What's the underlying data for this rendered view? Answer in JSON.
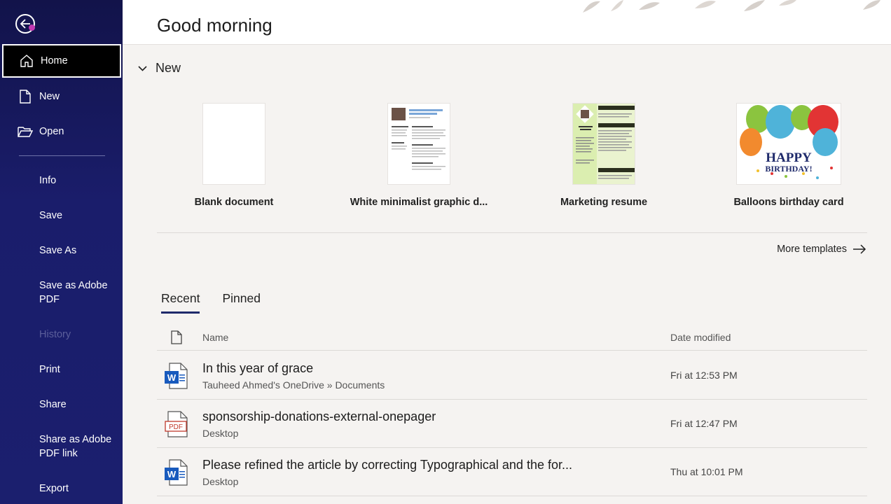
{
  "header": {
    "greeting": "Good morning"
  },
  "sidebar": {
    "back_icon": "back-arrow-icon",
    "items": [
      {
        "label": "Home",
        "icon": "home-icon",
        "active": true
      },
      {
        "label": "New",
        "icon": "new-document-icon"
      },
      {
        "label": "Open",
        "icon": "folder-open-icon"
      }
    ],
    "secondary": [
      {
        "label": "Info"
      },
      {
        "label": "Save"
      },
      {
        "label": "Save As"
      },
      {
        "label": "Save as Adobe\nPDF"
      },
      {
        "label": "History",
        "disabled": true
      },
      {
        "label": "Print"
      },
      {
        "label": "Share"
      },
      {
        "label": "Share as Adobe\nPDF link"
      },
      {
        "label": "Export"
      }
    ]
  },
  "new_section": {
    "title": "New",
    "templates": [
      {
        "label": "Blank document"
      },
      {
        "label": "White minimalist graphic d..."
      },
      {
        "label": "Marketing resume"
      },
      {
        "label": "Balloons birthday card",
        "card_text_1": "HAPPY",
        "card_text_2": "BIRTHDAY!"
      }
    ],
    "more_templates": "More templates"
  },
  "tabs": [
    {
      "label": "Recent",
      "active": true
    },
    {
      "label": "Pinned"
    }
  ],
  "list": {
    "columns": {
      "name": "Name",
      "date": "Date modified"
    },
    "rows": [
      {
        "name": "In this year of grace",
        "location": "Tauheed Ahmed's OneDrive » Documents",
        "date": "Fri at 12:53 PM",
        "type": "word"
      },
      {
        "name": "sponsorship-donations-external-onepager",
        "location": "Desktop",
        "date": "Fri at 12:47 PM",
        "type": "pdf",
        "badge": "PDF"
      },
      {
        "name": "Please refined the article by correcting Typographical and the for...",
        "location": "Desktop",
        "date": "Thu at 10:01 PM",
        "type": "word"
      }
    ]
  },
  "colors": {
    "sidebar": "#1b1f6e",
    "accent": "#c239b3",
    "word_blue": "#185abd",
    "pdf_red": "#c0392b"
  }
}
